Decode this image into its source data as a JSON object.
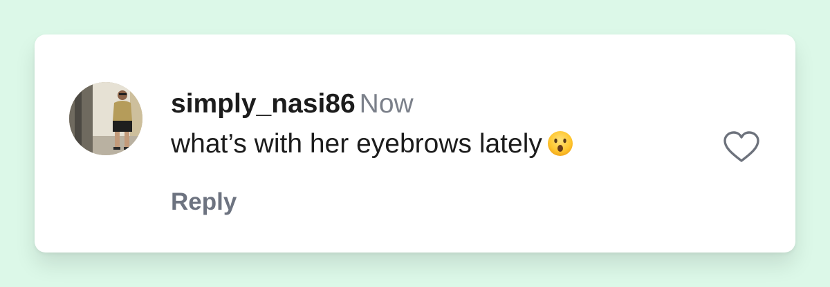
{
  "comment": {
    "username": "simply_nasi86",
    "timestamp": "Now",
    "text": "what’s with her eyebrows lately",
    "emoji_icon": "surprised-face-icon",
    "avatar_icon": "user-avatar-photo",
    "reply_label": "Reply",
    "like_icon": "heart-outline-icon"
  },
  "colors": {
    "background": "#dcf8e8",
    "card": "#ffffff",
    "text": "#1c1c1c",
    "muted": "#7b808a"
  }
}
